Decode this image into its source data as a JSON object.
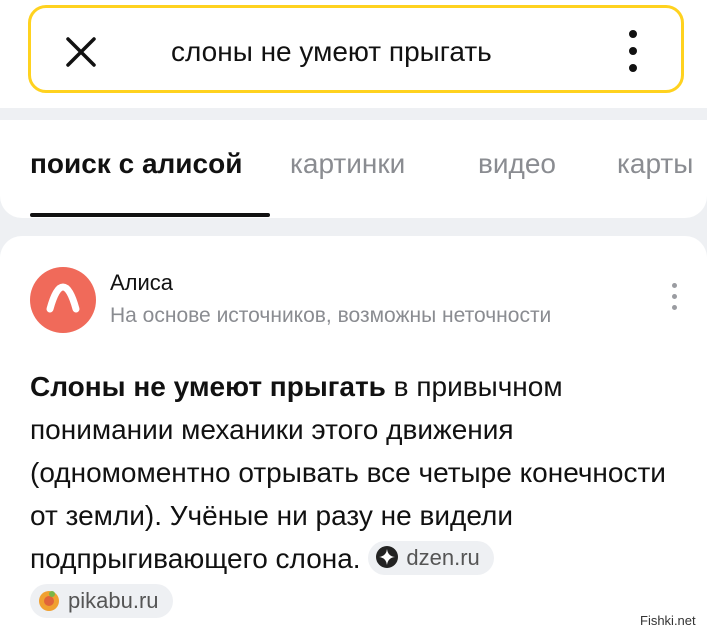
{
  "search": {
    "query": "слоны не умеют прыгать"
  },
  "tabs": [
    {
      "label": "поиск с алисой",
      "active": true
    },
    {
      "label": "картинки",
      "active": false
    },
    {
      "label": "видео",
      "active": false
    },
    {
      "label": "карты",
      "active": false
    }
  ],
  "answer_card": {
    "source_name": "Алиса",
    "disclaimer": "На основе источников, возможны неточности",
    "text_bold": "Слоны не умеют прыгать",
    "text_rest": " в привычном понимании механики этого движения (одномоментно отрывать все четыре конечности от земли). Учёные ни разу не видели подпрыгивающего слона.",
    "sources": [
      {
        "label": "dzen.ru",
        "icon": "dzen-icon"
      },
      {
        "label": "pikabu.ru",
        "icon": "pikabu-icon"
      }
    ]
  },
  "watermark": "Fishki.net",
  "colors": {
    "accent": "#ffd21f",
    "alisa": "#f06a5a",
    "muted": "#8a8c91"
  }
}
